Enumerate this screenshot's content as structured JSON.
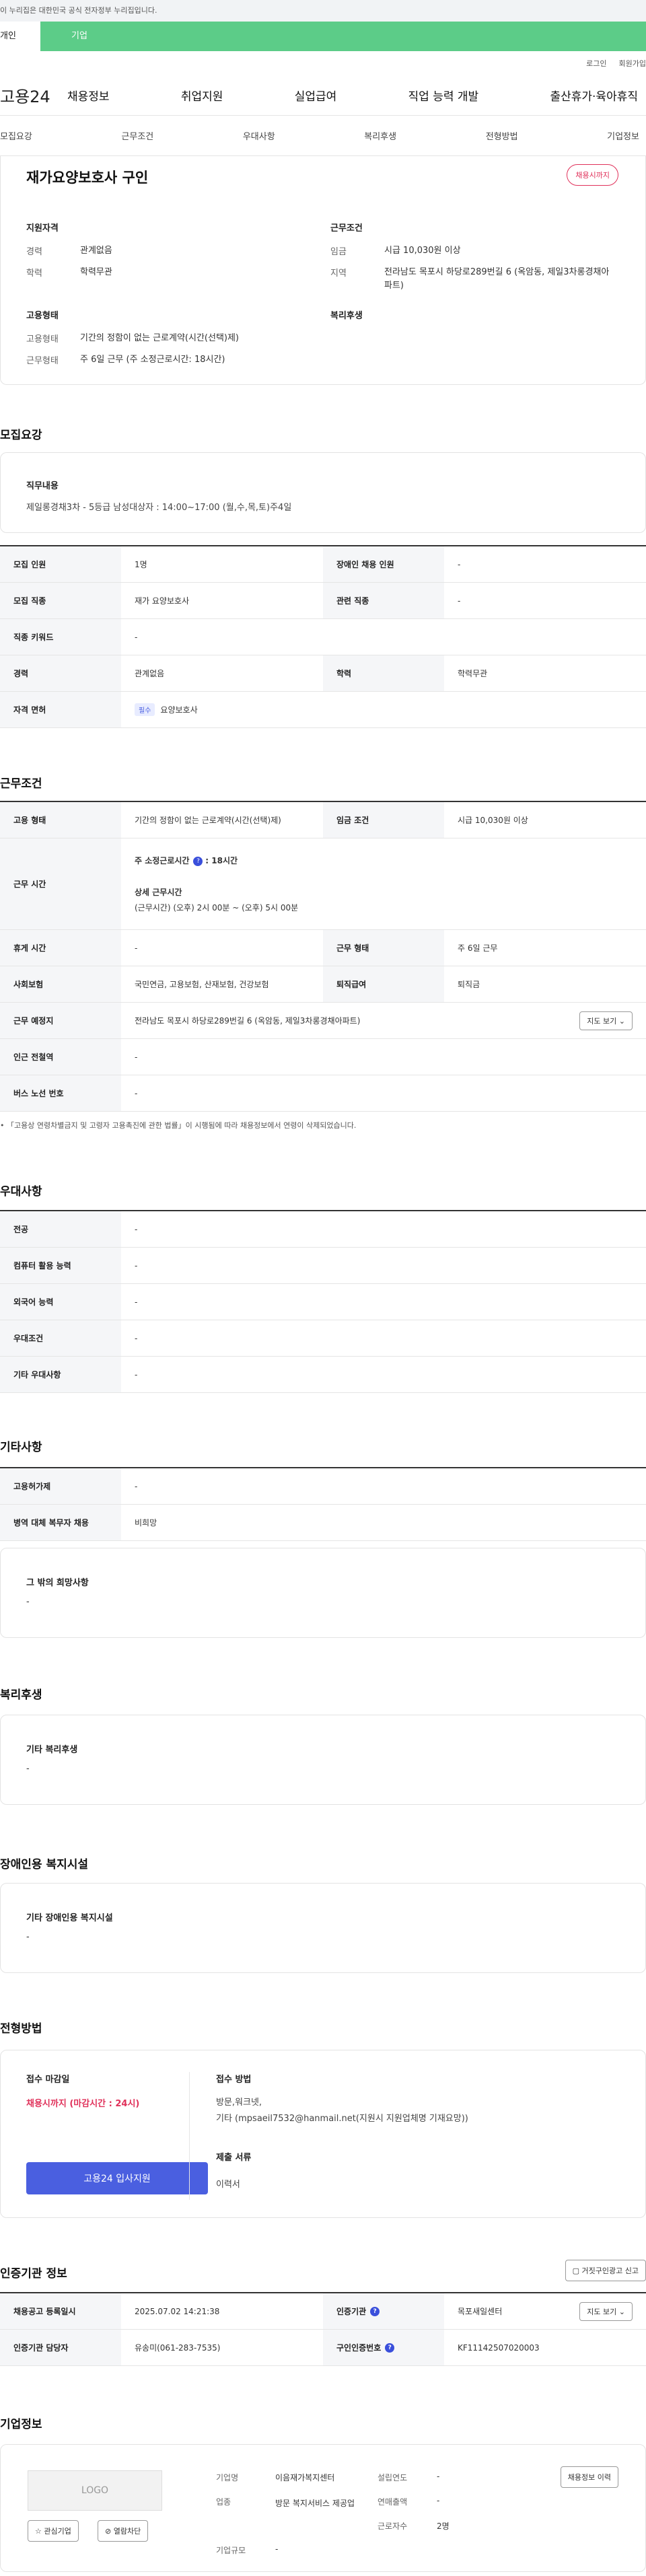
{
  "gov_banner": "이 누리집은 대한민국 공식 전자정부 누리집입니다.",
  "user_types": [
    "개인",
    "기업"
  ],
  "util": [
    "로그인",
    "회원가입"
  ],
  "logo": "고용24",
  "gnb": [
    "채용정보",
    "취업지원",
    "실업급여",
    "직업 능력 개발",
    "출산휴가·육아휴직"
  ],
  "lnb": [
    "모집요강",
    "근무조건",
    "우대사항",
    "복리후생",
    "전형방법",
    "기업정보"
  ],
  "summary": {
    "title": "재가요양보호사 구인",
    "status": "채용시까지",
    "qual_title": "지원자격",
    "exp_k": "경력",
    "exp_v": "관계없음",
    "edu_k": "학력",
    "edu_v": "학력무관",
    "form_title": "고용형태",
    "form_k": "고용형태",
    "form_v": "기간의 정함이 없는 근로계약(시간(선택)제)",
    "hours_k": "근무형태",
    "hours_v": "주 6일 근무 (주 소정근로시간: 18시간)",
    "cond_title": "근무조건",
    "wage_k": "임금",
    "wage_v": "시급 10,030원 이상",
    "area_k": "지역",
    "area_v": "전라남도 목포시 하당로289번길 6 (옥암동, 제일3차롱경채아파트)",
    "welfare_title": "복리후생"
  },
  "recruit": {
    "title": "모집요강",
    "job_title": "직무내용",
    "job_text": "제일롱경채3차 - 5등급 남성대상자 : 14:00~17:00 (월,수,목,토)주4일",
    "rows": [
      [
        "모집 인원",
        "1명",
        "장애인 채용 인원",
        "-"
      ],
      [
        "모집 직종",
        "재가 요양보호사",
        "관련 직종",
        "-"
      ],
      [
        "직종 키워드",
        "-"
      ],
      [
        "경력",
        "관계없음",
        "학력",
        "학력무관"
      ],
      [
        "자격 면허",
        "필수",
        "요양보호사"
      ]
    ]
  },
  "conditions": {
    "title": "근무조건",
    "emp_k": "고용 형태",
    "emp_v": "기간의 정함이 없는 근로계약(시간(선택)제)",
    "wage_k": "임금 조건",
    "wage_v": "시급 10,030원 이상",
    "time_k": "근무 시간",
    "time_l1": "주 소정근로시간",
    "time_v1": ": 18시간",
    "time_l2": "상세 근무시간",
    "time_v2": "(근무시간) (오후) 2시 00분 ~ (오후) 5시 00분",
    "rest_k": "휴게 시간",
    "rest_v": "-",
    "shape_k": "근무 형태",
    "shape_v": "주 6일 근무",
    "ins_k": "사회보험",
    "ins_v": "국민연금, 고용보험, 산재보험, 건강보험",
    "ret_k": "퇴직급여",
    "ret_v": "퇴직금",
    "place_k": "근무 예정지",
    "place_v": "전라남도 목포시 하당로289번길 6 (옥암동, 제일3차롱경채아파트)",
    "map_btn": "지도 보기",
    "sub_k": "인근 전철역",
    "sub_v": "-",
    "bus_k": "버스 노선 번호",
    "bus_v": "-",
    "note": "「고용상 연령차별금지 및 고령자 고용촉진에 관한 법률」이 시행됨에 따라 채용정보에서 연령이 삭제되었습니다."
  },
  "pref": {
    "title": "우대사항",
    "rows": [
      [
        "전공",
        "-"
      ],
      [
        "컴퓨터 활용 능력",
        "-"
      ],
      [
        "외국어 능력",
        "-"
      ],
      [
        "우대조건",
        "-"
      ],
      [
        "기타 우대사항",
        "-"
      ]
    ]
  },
  "other": {
    "title": "기타사항",
    "rows": [
      [
        "고용허가제",
        "-"
      ],
      [
        "병역 대체 복무자 채용",
        "비희망"
      ]
    ],
    "wish_title": "그 밖의 희망사항",
    "wish_v": "-"
  },
  "welfare": {
    "title": "복리후생",
    "box_title": "기타 복리후생",
    "box_v": "-"
  },
  "disabled": {
    "title": "장애인용 복지시설",
    "box_title": "기타 장애인용 복지시설",
    "box_v": "-"
  },
  "process": {
    "title": "전형방법",
    "deadline_t": "접수 마감일",
    "deadline_v": "채용시까지 (마감시간 : 24시)",
    "apply_btn": "고용24 입사지원",
    "method_t": "접수 방법",
    "method_v1": "방문,워크넷,",
    "method_v2": "기타 (mpsaeil7532@hanmail.net(지원시 지원업체명 기재요망))",
    "docs_t": "제출 서류",
    "docs_v": "이력서"
  },
  "cert": {
    "title": "인증기관 정보",
    "report_btn": "거짓구인광고 신고",
    "reg_k": "채용공고 등록일시",
    "reg_v": "2025.07.02 14:21:38",
    "org_k": "인증기관",
    "org_v": "목포새일센터",
    "map_btn": "지도 보기",
    "mgr_k": "인증기관 담당자",
    "mgr_v": "유송미(061-283-7535)",
    "num_k": "구인인증번호",
    "num_v": "KF11142507020003"
  },
  "company": {
    "title": "기업정보",
    "logo": "LOGO",
    "fav_btn": "관심기업",
    "block_btn": "열람차단",
    "name_k": "기업명",
    "name_v": "이음재가복지센터",
    "ind_k": "업종",
    "ind_v": "방문 복지서비스 제공업",
    "size_k": "기업규모",
    "size_v": "-",
    "est_k": "설립연도",
    "est_v": "-",
    "sales_k": "연매출액",
    "sales_v": "-",
    "emp_k": "근로자수",
    "emp_v": "2명",
    "hist_btn": "채용정보 이력"
  }
}
